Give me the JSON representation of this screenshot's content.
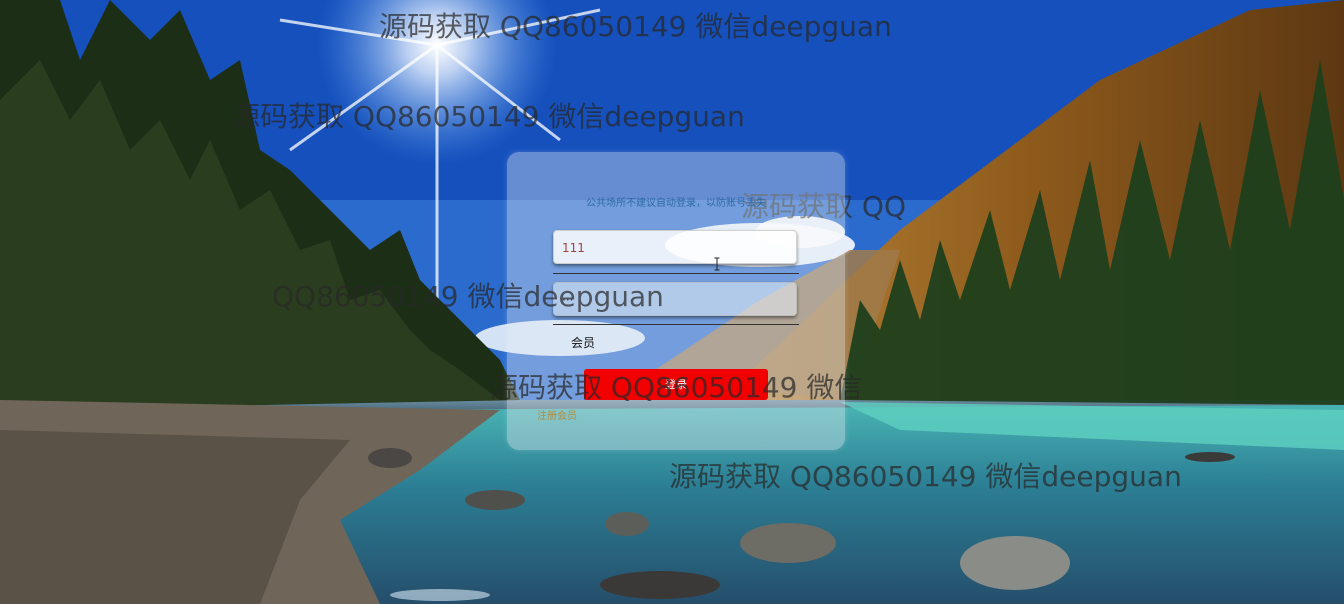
{
  "login": {
    "notice": "公共场所不建议自动登录，以防账号丢失",
    "username_value": "111",
    "password_value": "···",
    "role": "会员",
    "login_button": "登录",
    "register_link": "注册会员"
  },
  "watermarks": [
    "源码获取 QQ86050149 微信deepguan",
    "源码获取 QQ86050149 微信deepguan",
    "源码获取 QQ",
    "QQ86050149 微信deepguan",
    "源码获取 QQ86050149 微信",
    "源码获取 QQ86050149 微信deepguan"
  ],
  "colors": {
    "button": "#f20000",
    "notice": "#2e6aa5",
    "register": "#b58a3a"
  }
}
